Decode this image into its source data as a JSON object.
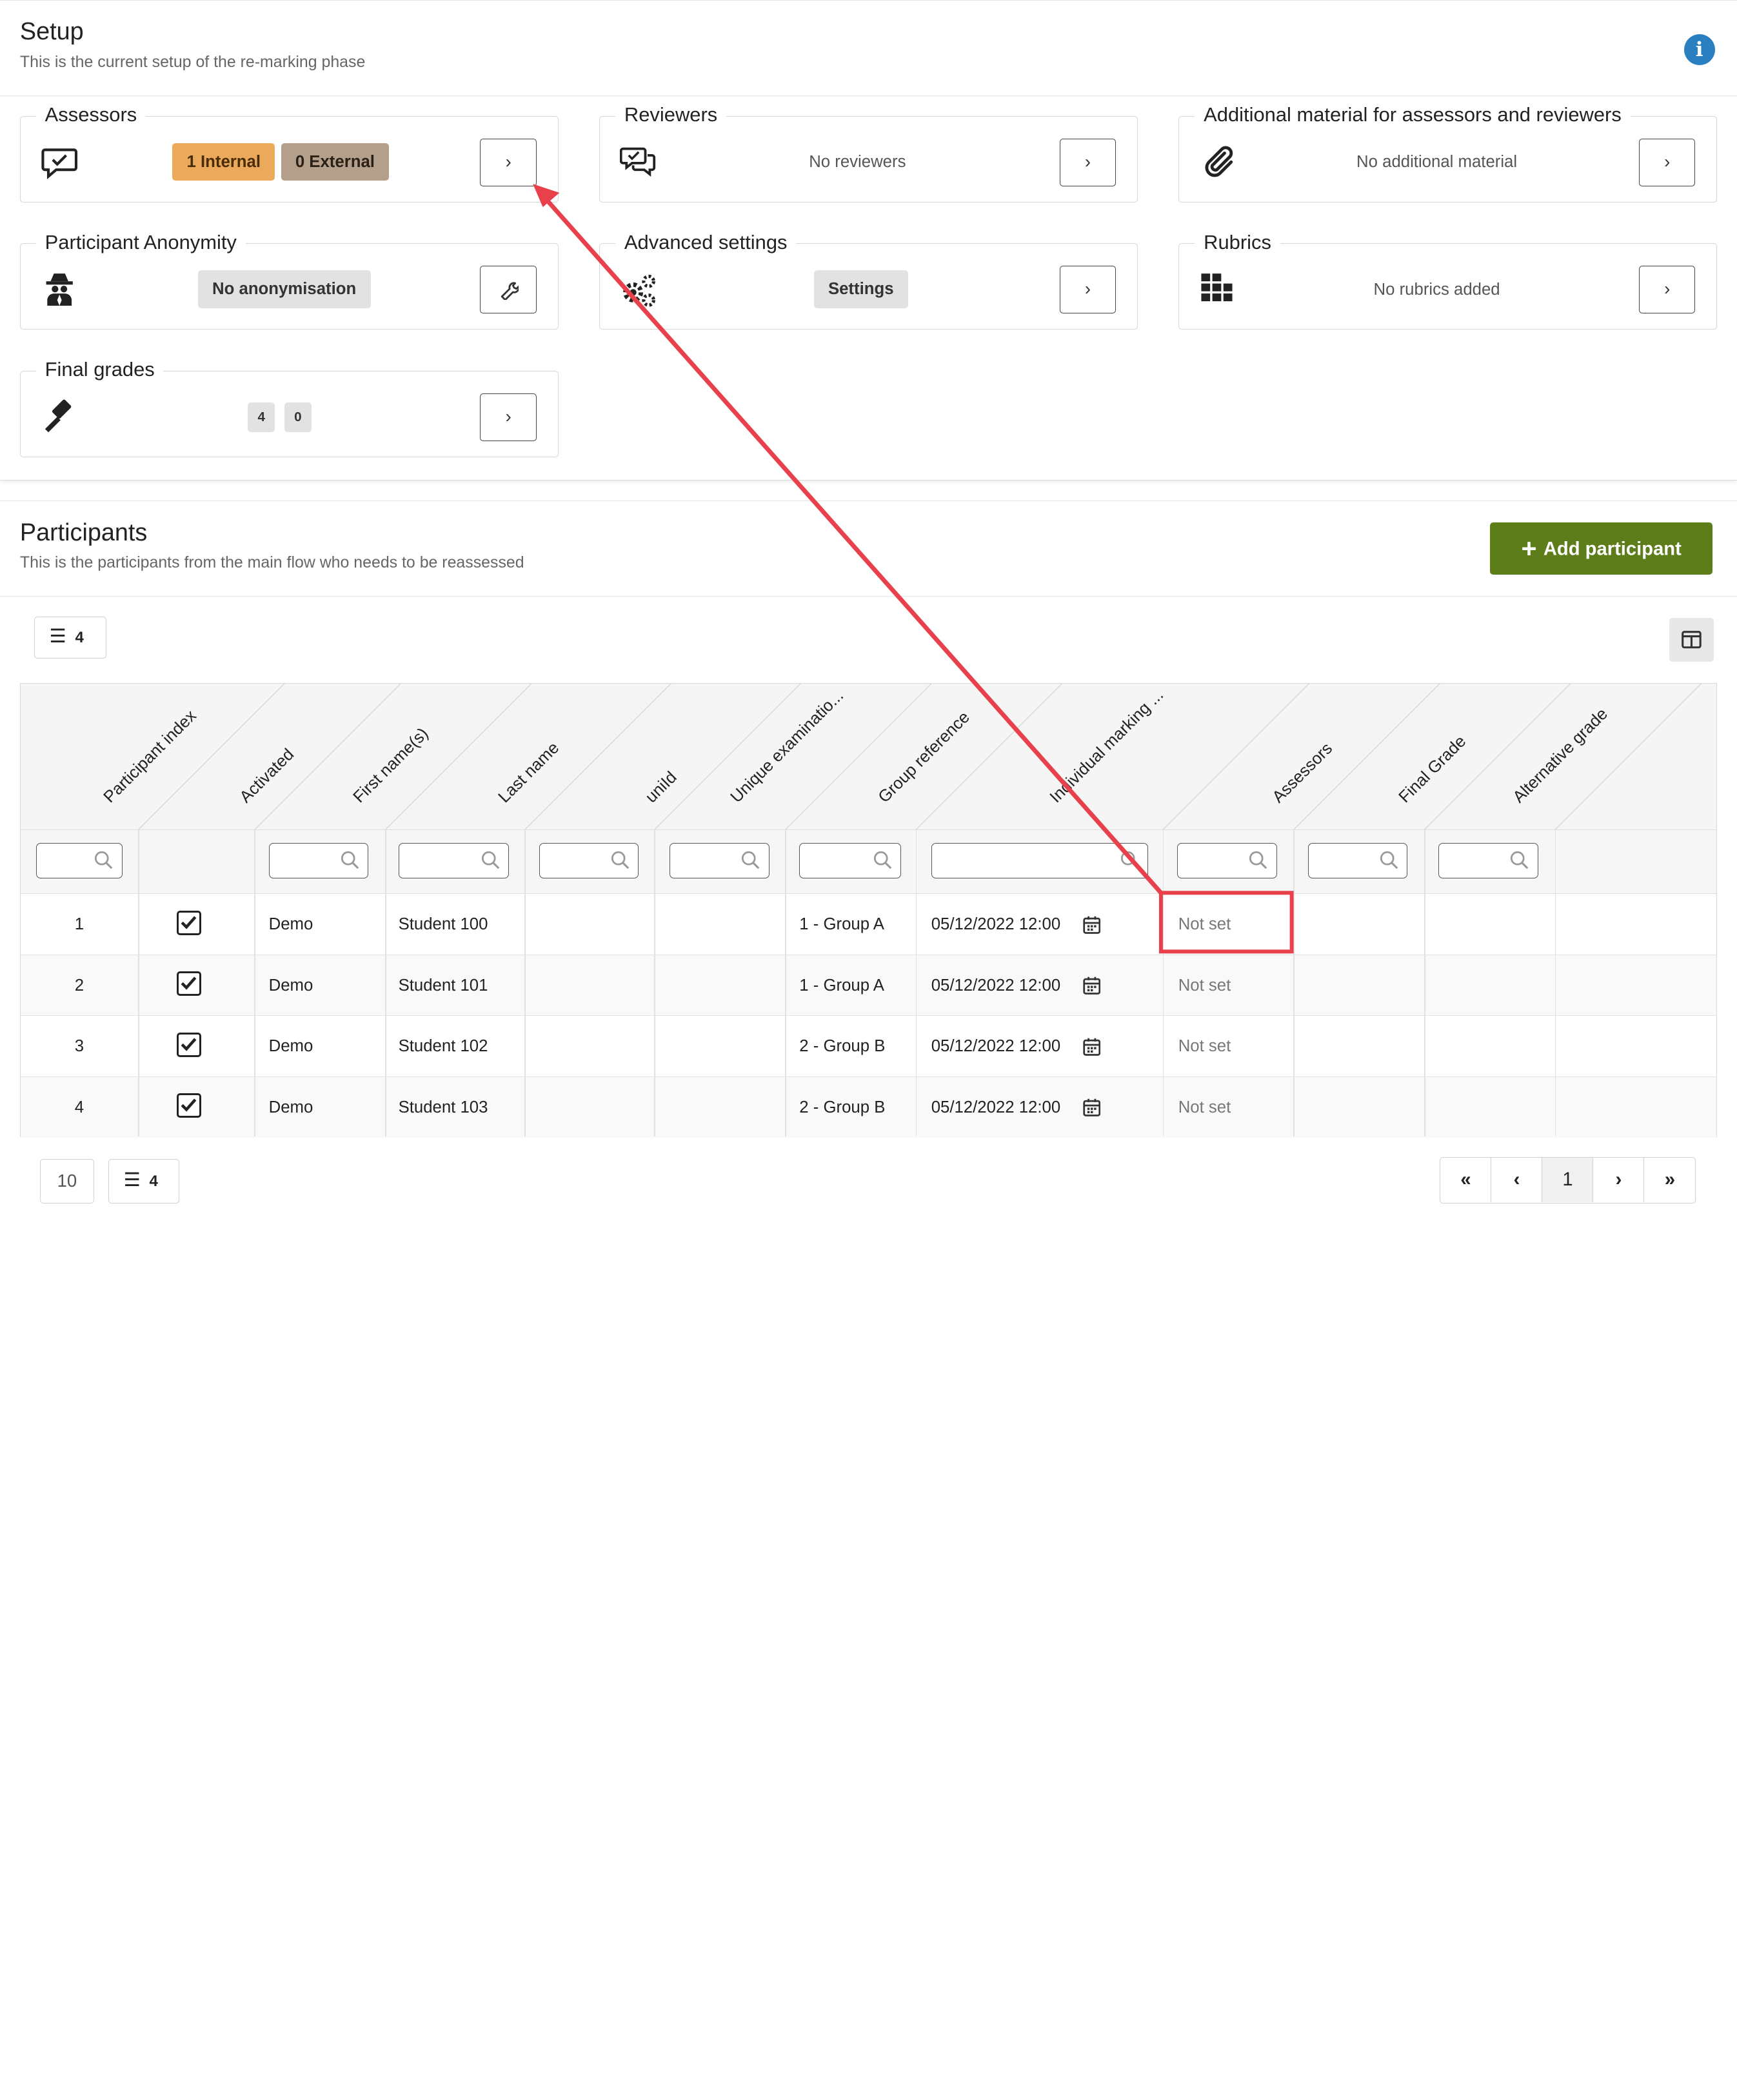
{
  "setup": {
    "title": "Setup",
    "subtitle": "This is the current setup of the re-marking phase",
    "cards": {
      "assessors": {
        "title": "Assessors",
        "internal": "1 Internal",
        "external": "0 External"
      },
      "reviewers": {
        "title": "Reviewers",
        "text": "No reviewers"
      },
      "material": {
        "title": "Additional material for assessors and reviewers",
        "text": "No additional material"
      },
      "anonymity": {
        "title": "Participant Anonymity",
        "chip": "No anonymisation"
      },
      "advanced": {
        "title": "Advanced settings",
        "chip": "Settings"
      },
      "rubrics": {
        "title": "Rubrics",
        "text": "No rubrics added"
      },
      "grades": {
        "title": "Final grades",
        "chip_a": "4",
        "chip_b": "0"
      }
    }
  },
  "participants": {
    "title": "Participants",
    "subtitle": "This is the participants from the main flow who needs to be reassessed",
    "add_label": "Add participant",
    "count": "4",
    "columns": [
      "Participant index",
      "Activated",
      "First name(s)",
      "Last name",
      "uniId",
      "Unique examinatio...",
      "Group reference",
      "Individual marking ...",
      "Assessors",
      "Final Grade",
      "Alternative grade"
    ],
    "rows": [
      {
        "index": "1",
        "first": "Demo",
        "last": "Student 100",
        "group": "1 - Group A",
        "deadline": "05/12/2022 12:00",
        "assessors": "Not set"
      },
      {
        "index": "2",
        "first": "Demo",
        "last": "Student 101",
        "group": "1 - Group A",
        "deadline": "05/12/2022 12:00",
        "assessors": "Not set"
      },
      {
        "index": "3",
        "first": "Demo",
        "last": "Student 102",
        "group": "2 - Group B",
        "deadline": "05/12/2022 12:00",
        "assessors": "Not set"
      },
      {
        "index": "4",
        "first": "Demo",
        "last": "Student 103",
        "group": "2 - Group B",
        "deadline": "05/12/2022 12:00",
        "assessors": "Not set"
      }
    ],
    "page_size": "10",
    "footer_count": "4",
    "pager": {
      "current": "1"
    }
  },
  "colors": {
    "accent": "#5d7d1b",
    "info": "#2a7fc1",
    "internal": "#eaa95b",
    "external": "#b39f8a",
    "annotation": "#e8414c"
  },
  "icons": [
    "info-icon",
    "chat-check-icon",
    "chat-icon",
    "paperclip-icon",
    "spy-icon",
    "cogs-icon",
    "grid-icon",
    "gavel-icon",
    "wrench-icon",
    "chevron-right-icon",
    "plus-icon",
    "list-icon",
    "columns-icon",
    "search-icon",
    "calendar-icon",
    "checkbox-icon"
  ]
}
